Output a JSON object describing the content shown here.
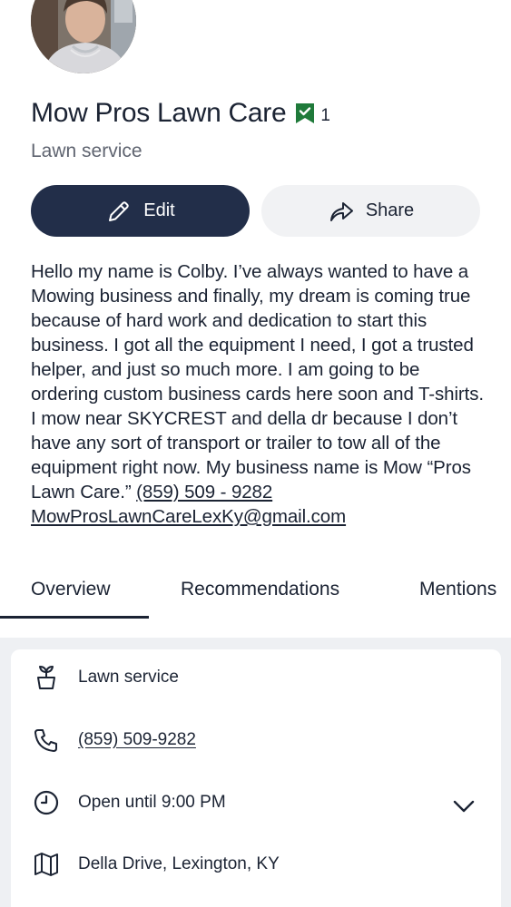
{
  "business": {
    "name": "Mow Pros Lawn Care",
    "recommendation_count": "1",
    "category": "Lawn service"
  },
  "actions": {
    "edit_label": "Edit",
    "share_label": "Share"
  },
  "description": {
    "text": "Hello my name is Colby. I’ve always wanted to have a Mowing business and finally, my dream is coming true because of hard work and dedication to start this business. I got all the equipment I need, I got a trusted helper, and just so much more. I am going to be ordering custom business cards here soon and T-shirts. I mow near SKYCREST and della dr because I don’t have any sort of transport or trailer to tow all of the equipment right now. My business name is Mow “Pros Lawn Care.”",
    "phone_link": "(859) 509 - 9282",
    "email_link": "MowProsLawnCareLexKy@gmail.com"
  },
  "tabs": [
    {
      "label": "Overview",
      "active": true
    },
    {
      "label": "Recommendations",
      "active": false
    },
    {
      "label": "Mentions",
      "active": false
    }
  ],
  "details": {
    "category": "Lawn service",
    "phone": "(859) 509-9282",
    "hours": "Open until 9:00 PM",
    "address": "Della Drive, Lexington, KY"
  },
  "icons": {
    "recommend": "bookmark-check-icon",
    "edit": "pencil-icon",
    "share": "share-arrow-icon",
    "category": "plant-pot-icon",
    "phone": "phone-icon",
    "hours": "clock-icon",
    "address": "map-icon",
    "expand": "chevron-down-icon"
  },
  "colors": {
    "primary_button": "#222e49",
    "secondary_button": "#f1f2f4",
    "badge_green": "#1f7a3a",
    "text": "#1b2333",
    "muted_text": "#5f6470",
    "section_bg": "#eef0f3"
  }
}
